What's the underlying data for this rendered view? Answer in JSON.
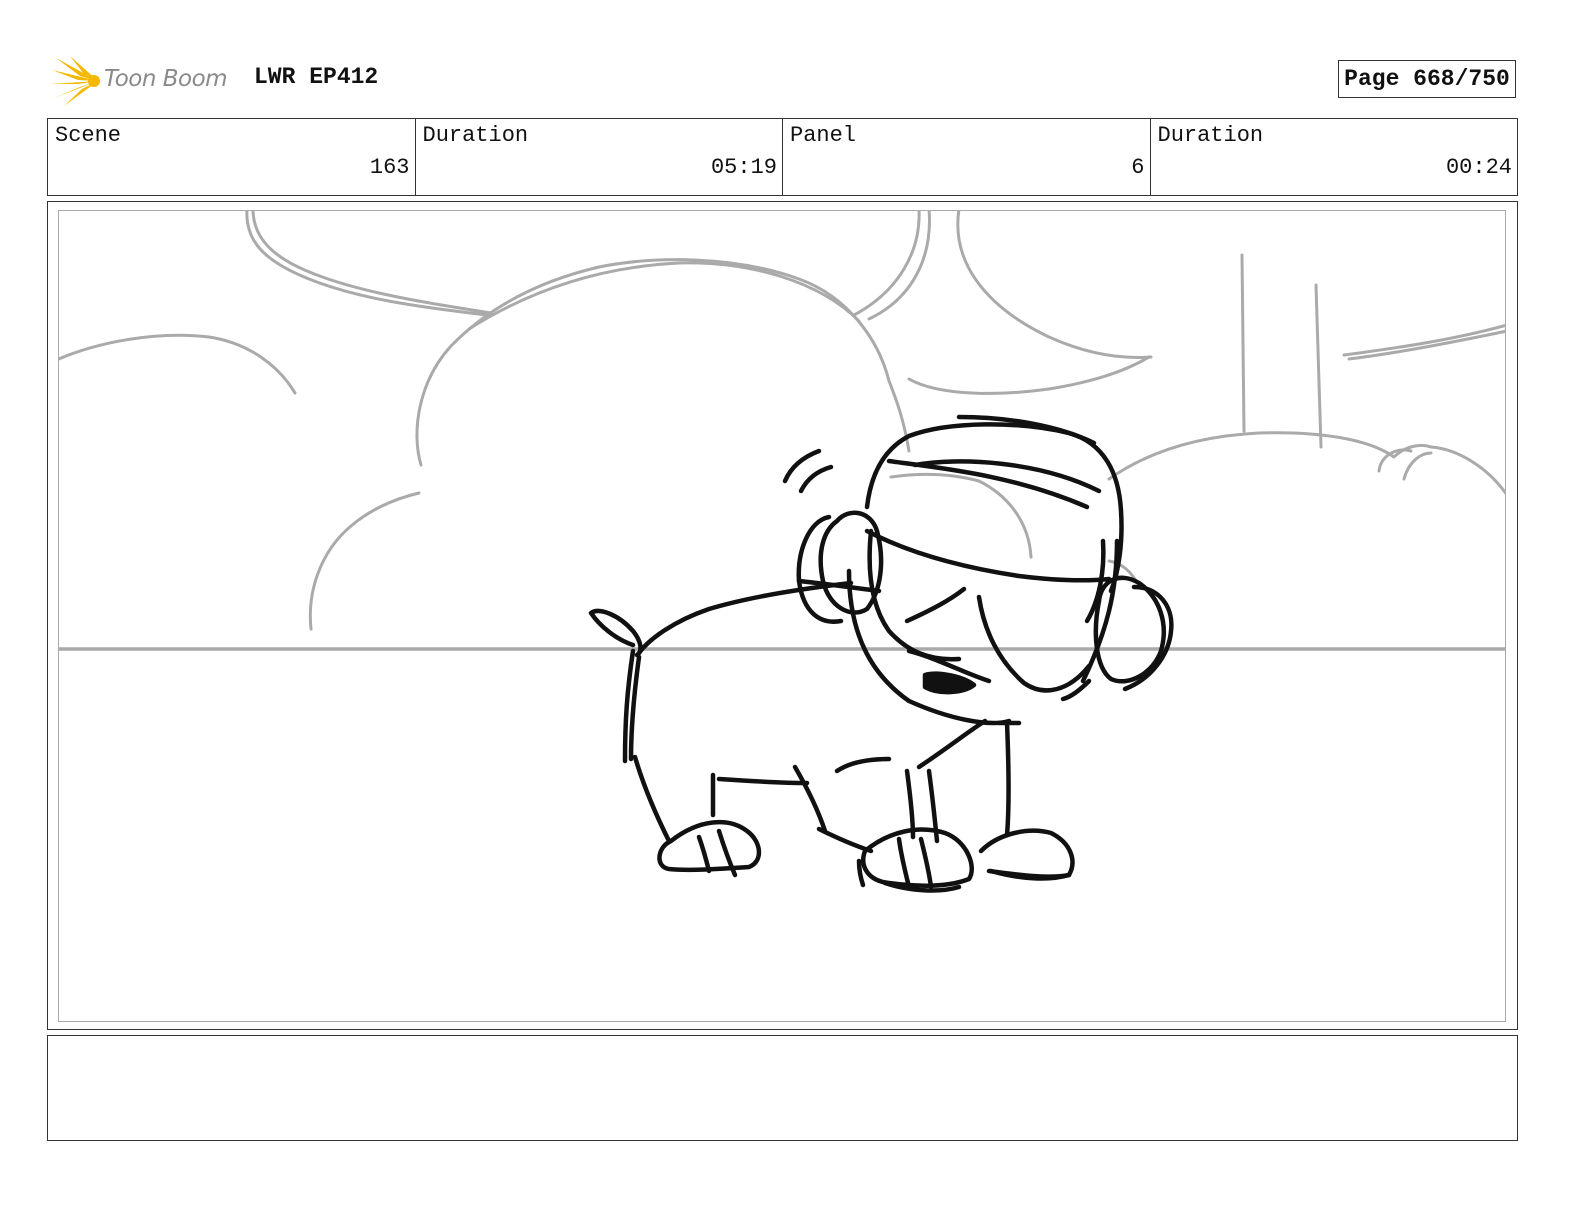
{
  "header": {
    "logo_text": "Toon Boom",
    "project_title": "LWR EP412",
    "page_label": "Page 668/750"
  },
  "info": [
    {
      "label": "Scene",
      "value": "163"
    },
    {
      "label": "Duration",
      "value": "05:19"
    },
    {
      "label": "Panel",
      "value": "6"
    },
    {
      "label": "Duration",
      "value": "00:24"
    }
  ],
  "colors": {
    "logo_accent": "#f5b800",
    "sketch_background": "#aaaaaa",
    "sketch_foreground": "#111111"
  },
  "notes": ""
}
